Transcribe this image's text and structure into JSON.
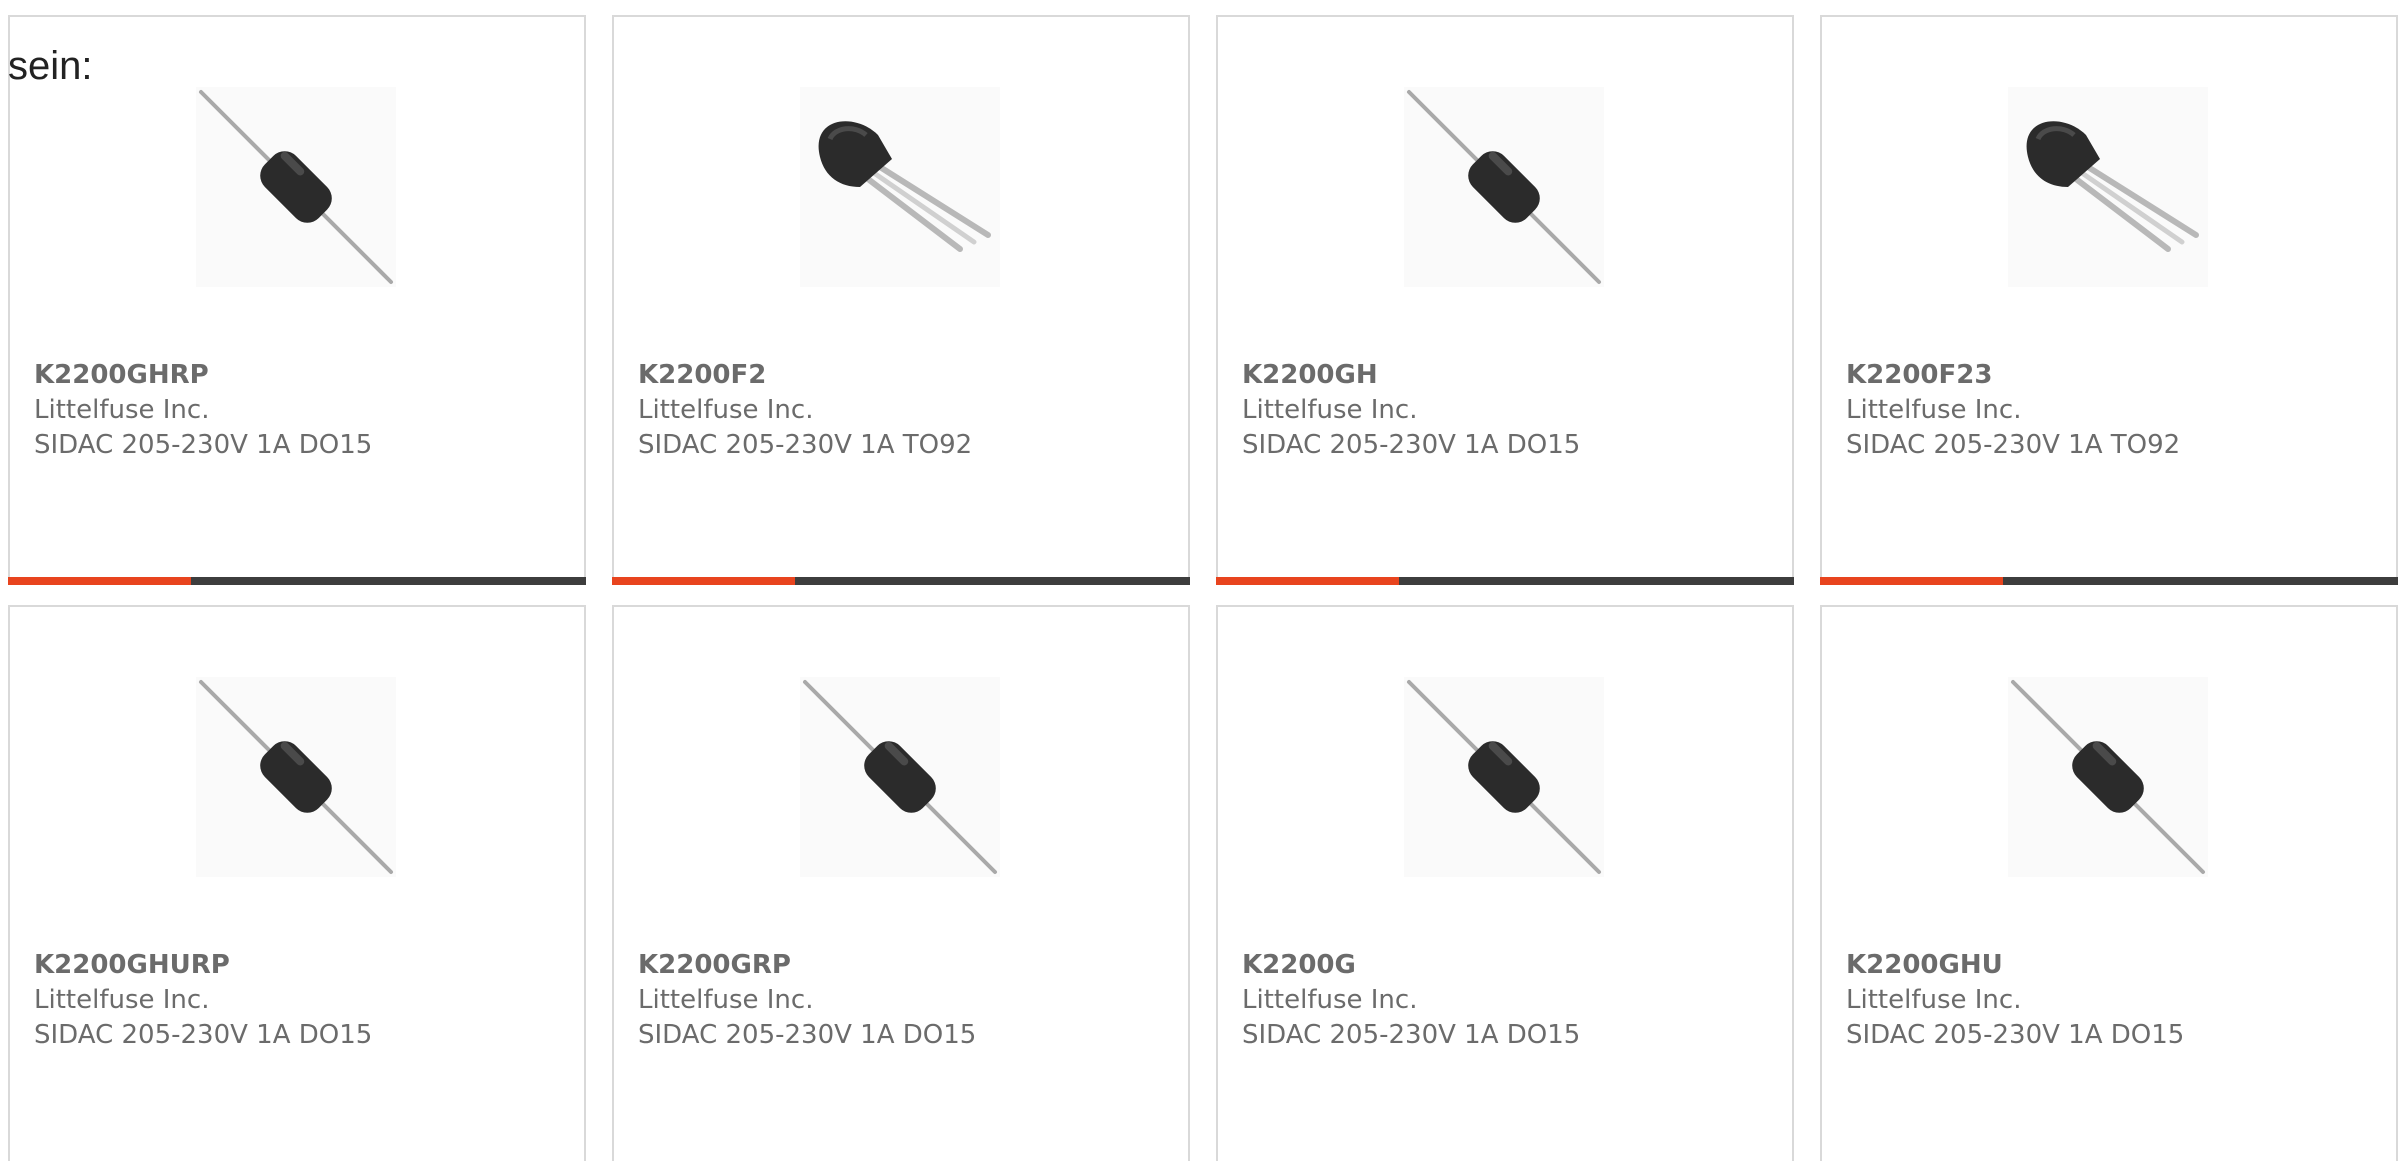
{
  "page": {
    "label": "sein:"
  },
  "colors": {
    "accent": "#e8441e",
    "bar": "#3d3d3d",
    "text": "#6b6b6b",
    "border": "#d9d9d9"
  },
  "products": [
    {
      "part": "K2200GHRP",
      "manufacturer": "Littelfuse Inc.",
      "description": "SIDAC 205-230V 1A DO15",
      "icon": "axial-diode-icon"
    },
    {
      "part": "K2200F2",
      "manufacturer": "Littelfuse Inc.",
      "description": "SIDAC 205-230V 1A TO92",
      "icon": "to92-package-icon"
    },
    {
      "part": "K2200GH",
      "manufacturer": "Littelfuse Inc.",
      "description": "SIDAC 205-230V 1A DO15",
      "icon": "axial-diode-icon"
    },
    {
      "part": "K2200F23",
      "manufacturer": "Littelfuse Inc.",
      "description": "SIDAC 205-230V 1A TO92",
      "icon": "to92-package-icon"
    },
    {
      "part": "K2200GHURP",
      "manufacturer": "Littelfuse Inc.",
      "description": "SIDAC 205-230V 1A DO15",
      "icon": "axial-diode-icon"
    },
    {
      "part": "K2200GRP",
      "manufacturer": "Littelfuse Inc.",
      "description": "SIDAC 205-230V 1A DO15",
      "icon": "axial-diode-icon"
    },
    {
      "part": "K2200G",
      "manufacturer": "Littelfuse Inc.",
      "description": "SIDAC 205-230V 1A DO15",
      "icon": "axial-diode-icon"
    },
    {
      "part": "K2200GHU",
      "manufacturer": "Littelfuse Inc.",
      "description": "SIDAC 205-230V 1A DO15",
      "icon": "axial-diode-icon"
    }
  ]
}
